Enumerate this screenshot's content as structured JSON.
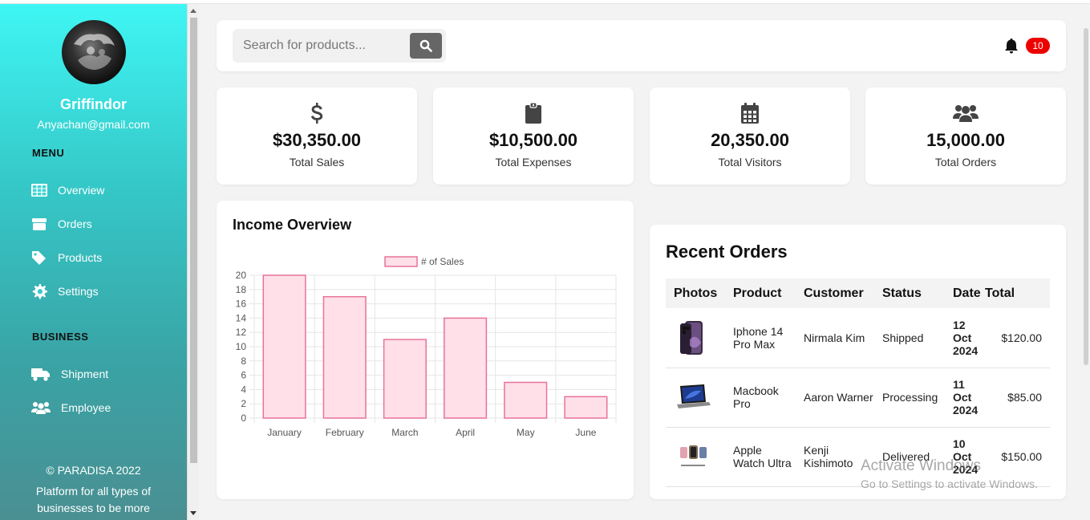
{
  "sidebar": {
    "brand": "Griffindor",
    "email": "Anyachan@gmail.com",
    "menu_title": "MENU",
    "menu": [
      {
        "label": "Overview",
        "icon": "grid-icon"
      },
      {
        "label": "Orders",
        "icon": "box-icon"
      },
      {
        "label": "Products",
        "icon": "tag-icon"
      },
      {
        "label": "Settings",
        "icon": "gear-icon"
      }
    ],
    "business_title": "BUSINESS",
    "business": [
      {
        "label": "Shipment",
        "icon": "truck-icon"
      },
      {
        "label": "Employee",
        "icon": "users-icon"
      }
    ],
    "copyright": "© PARADISA 2022",
    "tagline_1": "Platform for all types of",
    "tagline_2": "businesses to be more"
  },
  "topbar": {
    "search_placeholder": "Search for products...",
    "notification_count": "10"
  },
  "stats": [
    {
      "value": "$30,350.00",
      "label": "Total Sales",
      "icon": "dollar-icon"
    },
    {
      "value": "$10,500.00",
      "label": "Total Expenses",
      "icon": "clipboard-icon"
    },
    {
      "value": "20,350.00",
      "label": "Total Visitors",
      "icon": "calendar-icon"
    },
    {
      "value": "15,000.00",
      "label": "Total Orders",
      "icon": "users-icon"
    }
  ],
  "income": {
    "title": "Income Overview"
  },
  "chart_data": {
    "type": "bar",
    "title": "",
    "categories": [
      "January",
      "February",
      "March",
      "April",
      "May",
      "June"
    ],
    "series": [
      {
        "name": "# of Sales",
        "values": [
          20,
          17,
          11,
          14,
          5,
          3
        ]
      }
    ],
    "ylim": [
      0,
      20
    ],
    "yticks": [
      0,
      2,
      4,
      6,
      8,
      10,
      12,
      14,
      16,
      18,
      20
    ],
    "legend": "top-center",
    "grid": true,
    "colors": {
      "fill": "#ffe0e8",
      "stroke": "#e8739a"
    }
  },
  "orders": {
    "title": "Recent Orders",
    "headers": [
      "Photos",
      "Product",
      "Customer",
      "Status",
      "Date",
      "Total"
    ],
    "rows": [
      {
        "product": "Iphone 14 Pro Max",
        "customer": "Nirmala Kim",
        "status": "Shipped",
        "date_day": "12",
        "date_month": "Oct",
        "date_year": "2024",
        "total": "$120.00"
      },
      {
        "product": "Macbook Pro",
        "customer": "Aaron Warner",
        "status": "Processing",
        "date_day": "11",
        "date_month": "Oct",
        "date_year": "2024",
        "total": "$85.00"
      },
      {
        "product": "Apple Watch Ultra",
        "customer": "Kenji Kishimoto",
        "status": "Delivered",
        "date_day": "10",
        "date_month": "Oct",
        "date_year": "2024",
        "total": "$150.00"
      }
    ]
  },
  "watermark": {
    "line1": "Activate Windows",
    "line2": "Go to Settings to activate Windows."
  }
}
